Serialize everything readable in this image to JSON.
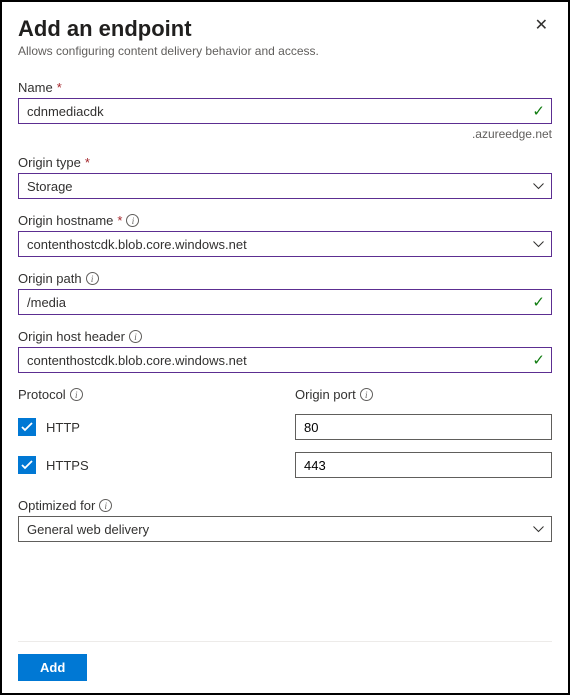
{
  "header": {
    "title": "Add an endpoint",
    "subtitle": "Allows configuring content delivery behavior and access."
  },
  "fields": {
    "name_label": "Name",
    "name_value": "cdnmediacdk",
    "name_suffix": ".azureedge.net",
    "origin_type_label": "Origin type",
    "origin_type_value": "Storage",
    "origin_hostname_label": "Origin hostname",
    "origin_hostname_value": "contenthostcdk.blob.core.windows.net",
    "origin_path_label": "Origin path",
    "origin_path_value": "/media",
    "origin_host_header_label": "Origin host header",
    "origin_host_header_value": "contenthostcdk.blob.core.windows.net",
    "protocol_label": "Protocol",
    "origin_port_label": "Origin port",
    "http_label": "HTTP",
    "https_label": "HTTPS",
    "http_port": "80",
    "https_port": "443",
    "optimized_label": "Optimized for",
    "optimized_value": "General web delivery"
  },
  "footer": {
    "add_label": "Add"
  }
}
